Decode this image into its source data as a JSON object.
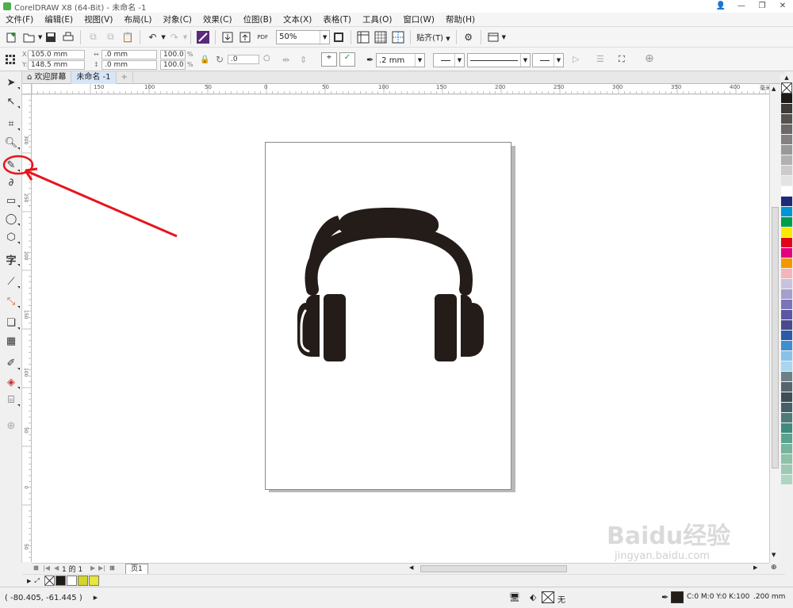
{
  "window": {
    "title": "CorelDRAW X8 (64-Bit) - 未命名 -1"
  },
  "menu": [
    "文件(F)",
    "编辑(E)",
    "视图(V)",
    "布局(L)",
    "对象(C)",
    "效果(C)",
    "位图(B)",
    "文本(X)",
    "表格(T)",
    "工具(O)",
    "窗口(W)",
    "帮助(H)"
  ],
  "toolbar": {
    "zoom": "50%",
    "snap_label": "贴齐(T)",
    "pdf_label": "PDF"
  },
  "props": {
    "x": "105.0 mm",
    "y": "148.5 mm",
    "w": ".0 mm",
    "h": ".0 mm",
    "sx": "100.0",
    "sy": "100.0",
    "pct": "%",
    "angle": ".0",
    "outline_width": ".2 mm"
  },
  "tabs": [
    {
      "label": "欢迎屏幕"
    },
    {
      "label": "未命名 -1"
    }
  ],
  "ruler": {
    "h_ticks": [
      "150",
      "100",
      "50",
      "0",
      "50",
      "100",
      "150",
      "200",
      "250",
      "300",
      "350",
      "400"
    ],
    "h_unit": "毫米",
    "v_ticks": [
      "300",
      "250",
      "200",
      "150",
      "100",
      "50",
      "0",
      "50"
    ]
  },
  "pages": {
    "current": "1",
    "of": "的",
    "total": "1",
    "tab": "页1"
  },
  "status": {
    "coords": "( -80.405, -61.445 )",
    "fill_none": "无",
    "color_info": "C:0 M:0 Y:0 K:100",
    "outline_size": ".200 mm"
  },
  "palette_colors": [
    "#1e1a17",
    "#3d3a38",
    "#555250",
    "#6b6866",
    "#828080",
    "#9a9898",
    "#b3b1b0",
    "#cccaca",
    "#e4e3e2",
    "#ffffff",
    "#1c2a7a",
    "#0096d6",
    "#009e49",
    "#ffe600",
    "#e2001a",
    "#e4007f",
    "#f39800",
    "#f4b4b8",
    "#c9c2df",
    "#a49fce",
    "#7b75b8",
    "#5c57a4",
    "#4a4a8c",
    "#2b5aa8",
    "#3e8fcf",
    "#87c3e8",
    "#a8d5ef",
    "#6e7f86",
    "#55656d",
    "#3f4d55",
    "#475f69",
    "#4f7b78",
    "#3f8b7c",
    "#5aa390",
    "#75b49d",
    "#8dc2a8",
    "#9dcab3",
    "#aed5c2"
  ],
  "doc_palette": [
    "#1e1a17",
    "#ffffff",
    "#d4d42a",
    "#e6e63c"
  ],
  "colors": {
    "accent_red": "#e8141b",
    "icon_dark": "#231c18",
    "tab_active": "#d6e6f7"
  },
  "watermark": {
    "text": "Baidu经验",
    "url": "jingyan.baidu.com"
  }
}
